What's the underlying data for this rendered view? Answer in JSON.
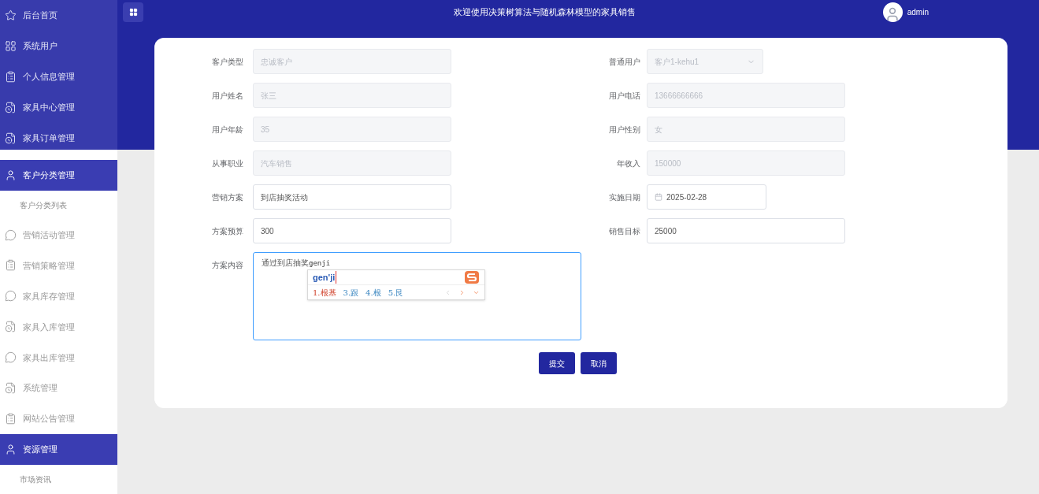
{
  "header": {
    "title": "欢迎使用决策树算法与随机森林模型的家具销售",
    "user": "admin"
  },
  "sidebar": {
    "banner_items": [
      {
        "label": "后台首页",
        "kind": "star",
        "selected": false
      },
      {
        "label": "系统用户",
        "kind": "grid",
        "selected": false
      },
      {
        "label": "个人信息管理",
        "kind": "clipboard",
        "selected": false
      },
      {
        "label": "家具中心管理",
        "kind": "file",
        "selected": false
      },
      {
        "label": "家具订单管理",
        "kind": "file",
        "selected": false
      }
    ],
    "items": [
      {
        "label": "客户分类管理",
        "kind": "user",
        "selected": true,
        "children": [
          {
            "label": "客户分类列表",
            "selected": false
          }
        ]
      },
      {
        "label": "营销活动管理",
        "kind": "message",
        "selected": false
      },
      {
        "label": "营销策略管理",
        "kind": "clipboard",
        "selected": false
      },
      {
        "label": "家具库存管理",
        "kind": "message",
        "selected": false
      },
      {
        "label": "家具入库管理",
        "kind": "file",
        "selected": false
      },
      {
        "label": "家具出库管理",
        "kind": "message",
        "selected": false
      },
      {
        "label": "系统管理",
        "kind": "file",
        "selected": false
      },
      {
        "label": "网站公告管理",
        "kind": "clipboard",
        "selected": false
      },
      {
        "label": "资源管理",
        "kind": "user",
        "selected": true,
        "children": [
          {
            "label": "市场资讯",
            "selected": false
          }
        ]
      }
    ]
  },
  "form": {
    "rows": [
      [
        {
          "label": "客户类型",
          "kind": "text",
          "value": "忠诚客户",
          "disabled": true
        },
        {
          "label": "普通用户",
          "kind": "select",
          "value": "客户1-kehu1",
          "disabled": true
        }
      ],
      [
        {
          "label": "用户姓名",
          "kind": "text",
          "value": "张三",
          "disabled": true
        },
        {
          "label": "用户电话",
          "kind": "text",
          "value": "13666666666",
          "disabled": true
        }
      ],
      [
        {
          "label": "用户年龄",
          "kind": "text",
          "value": "35",
          "disabled": true
        },
        {
          "label": "用户性别",
          "kind": "text",
          "value": "女",
          "disabled": true
        }
      ],
      [
        {
          "label": "从事职业",
          "kind": "text",
          "value": "汽车销售",
          "disabled": true
        },
        {
          "label": "年收入",
          "kind": "text",
          "value": "150000",
          "disabled": true
        }
      ],
      [
        {
          "label": "营销方案",
          "kind": "text",
          "value": "到店抽奖活动",
          "disabled": false
        },
        {
          "label": "实施日期",
          "kind": "date",
          "value": "2025-02-28",
          "disabled": false
        }
      ],
      [
        {
          "label": "方案预算",
          "kind": "text",
          "value": "300",
          "disabled": false
        },
        {
          "label": "销售目标",
          "kind": "text",
          "value": "25000",
          "disabled": false
        }
      ]
    ],
    "content": {
      "label": "方案内容",
      "value": "通过到店抽奖",
      "composing": "genji"
    },
    "ime": {
      "input": "gen'ji",
      "candidates": [
        {
          "index": "1.",
          "text": "根基",
          "selected": true
        },
        {
          "index": "3.",
          "text": "跟",
          "selected": false
        },
        {
          "index": "4.",
          "text": "根",
          "selected": false
        },
        {
          "index": "5.",
          "text": "艮",
          "selected": false
        }
      ]
    },
    "buttons": [
      {
        "label": "提交"
      },
      {
        "label": "取消"
      }
    ]
  }
}
